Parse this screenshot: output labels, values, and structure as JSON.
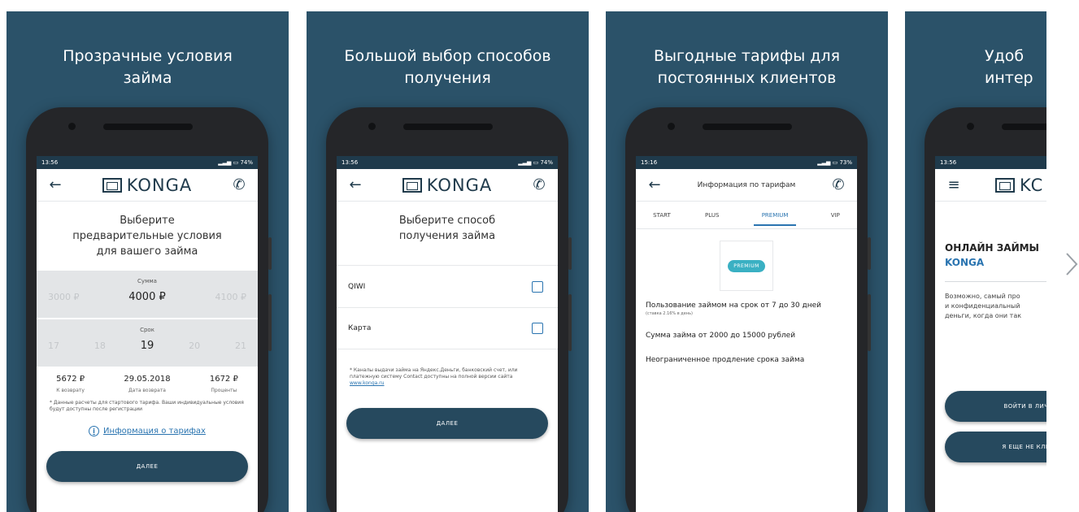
{
  "cards": [
    {
      "title_line1": "Прозрачные  условия",
      "title_line2": "займа",
      "status_time": "13:56",
      "status_right": "74%",
      "logo_text": "KONGA",
      "heading_line1": "Выберите",
      "heading_line2": "предварительные условия",
      "heading_line3": "для вашего займа",
      "amount_label": "Сумма",
      "amount_prev": "3000 ₽",
      "amount_selected": "4000 ₽",
      "amount_next": "4100 ₽",
      "term_label": "Срок",
      "term_values": [
        "17",
        "18",
        "19",
        "20",
        "21"
      ],
      "summary": [
        {
          "value": "5672 ₽",
          "label": "К возврату"
        },
        {
          "value": "29.05.2018",
          "label": "Дата возврата"
        },
        {
          "value": "1672 ₽",
          "label": "Проценты"
        }
      ],
      "note": "* Данные расчеты для стартового тарифа. Ваши индивидуальные условия будут доступны после регистрации",
      "info_link": "Информация о тарифах",
      "button": "ДАЛЕЕ"
    },
    {
      "title_line1": "Большой выбор способов",
      "title_line2": "получения",
      "status_time": "13:56",
      "status_right": "74%",
      "logo_text": "KONGA",
      "heading_line1": "Выберите способ",
      "heading_line2": "получения займа",
      "methods": [
        {
          "label": "QIWI"
        },
        {
          "label": "Карта"
        }
      ],
      "note": "* Каналы выдачи займа на Яндекс.Деньги, банковский счет, или платежную систему Contact доступны на полной версии сайта",
      "note_link": "www.konga.ru",
      "button": "ДАЛЕЕ"
    },
    {
      "title_line1": "Выгодные тарифы для",
      "title_line2": "постоянных клиентов",
      "status_time": "15:16",
      "status_right": "73%",
      "screen_title": "Информация по тарифам",
      "tabs": [
        "START",
        "PLUS",
        "PREMIUM",
        "VIP"
      ],
      "badge": "PREMIUM",
      "line1": "Пользование займом на срок от 7 до 30 дней",
      "line1_sub": "(ставка 2.16% в день)",
      "line2": "Сумма займа от 2000 до 15000 рублей",
      "line3": "Неограниченное продление срока займа"
    },
    {
      "title_line1": "Удоб",
      "title_line2": "интер",
      "status_time": "13:56",
      "logo_text": "KC",
      "promo_title": "ОНЛАЙН ЗАЙМЫ",
      "promo_brand": "KONGA",
      "promo_line1": "Возможно, самый про",
      "promo_line2": "и конфиденциальный",
      "promo_line3": "деньги, когда они так",
      "button1": "ВОЙТИ В ЛИЧ",
      "button2": "Я ЕЩЕ НЕ КЛИ"
    }
  ],
  "colors": {
    "card_bg": "#2b5269",
    "button_bg": "#26495e",
    "accent": "#2a74b0",
    "badge": "#3ab0c3"
  },
  "icons": [
    "back-arrow-icon",
    "phone-icon",
    "menu-icon",
    "info-icon",
    "chevron-right-icon",
    "signal-icon",
    "battery-icon"
  ]
}
